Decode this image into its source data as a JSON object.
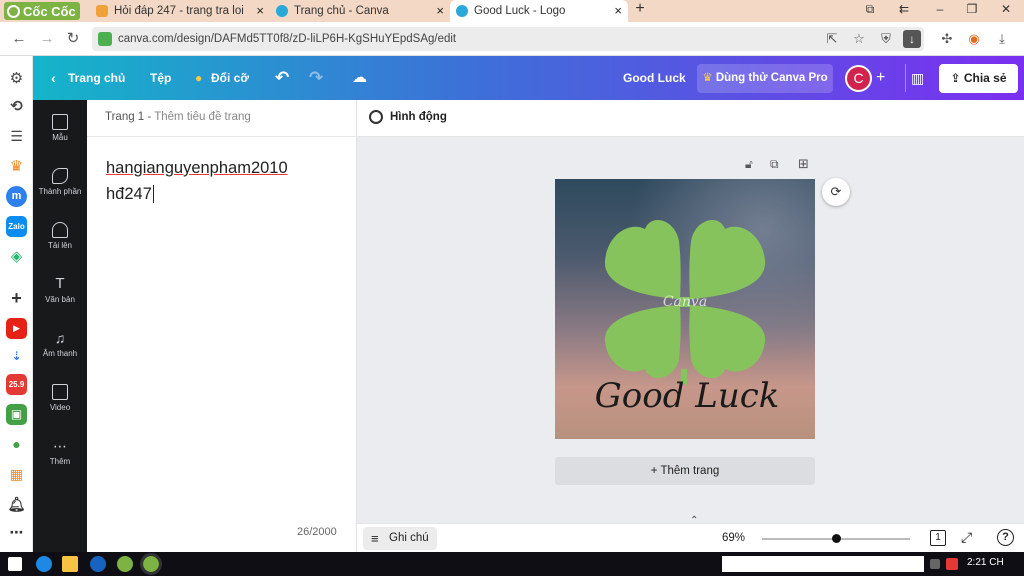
{
  "browser": {
    "brand": "Cốc Cốc",
    "tabs": [
      {
        "label": "Hỏi đáp 247 - trang tra loi",
        "active": false
      },
      {
        "label": "Trang chủ - Canva",
        "active": false
      },
      {
        "label": "Good Luck - Logo",
        "active": true
      }
    ],
    "url": "canva.com/design/DAFMd5TT0f8/zD-liLP6H-KgSHuYEpdSAg/edit"
  },
  "header": {
    "home": "Trang chủ",
    "file": "Tệp",
    "resize": "Đổi cỡ",
    "doc_title": "Good Luck",
    "try_pro": "Dùng thử Canva Pro",
    "avatar_letter": "C",
    "share": "Chia sẻ"
  },
  "side_panel": [
    {
      "label": "Mẫu",
      "icon": "template-icon"
    },
    {
      "label": "Thành phần",
      "icon": "elements-icon"
    },
    {
      "label": "Tải lên",
      "icon": "upload-icon"
    },
    {
      "label": "Văn bản",
      "icon": "text-icon"
    },
    {
      "label": "Âm thanh",
      "icon": "audio-icon"
    },
    {
      "label": "Video",
      "icon": "video-icon"
    },
    {
      "label": "Thêm",
      "icon": "more-icon"
    }
  ],
  "notes": {
    "page_label": "Trang 1",
    "page_title_placeholder": "Thêm tiêu đề trang",
    "line1": "hangianguyenpham2010",
    "line2": "hđ247",
    "counter": "26/2000"
  },
  "toolbar": {
    "animate": "Hình động"
  },
  "design": {
    "watermark": "Canva",
    "script_text": "Good Luck",
    "clover_color": "#86c35c"
  },
  "add_page": "+ Thêm trang",
  "footer": {
    "notes_button": "Ghi chú",
    "zoom": "69%",
    "zoom_fraction": 0.5,
    "page_count": "1"
  },
  "taskbar": {
    "time": "2:21 CH"
  }
}
